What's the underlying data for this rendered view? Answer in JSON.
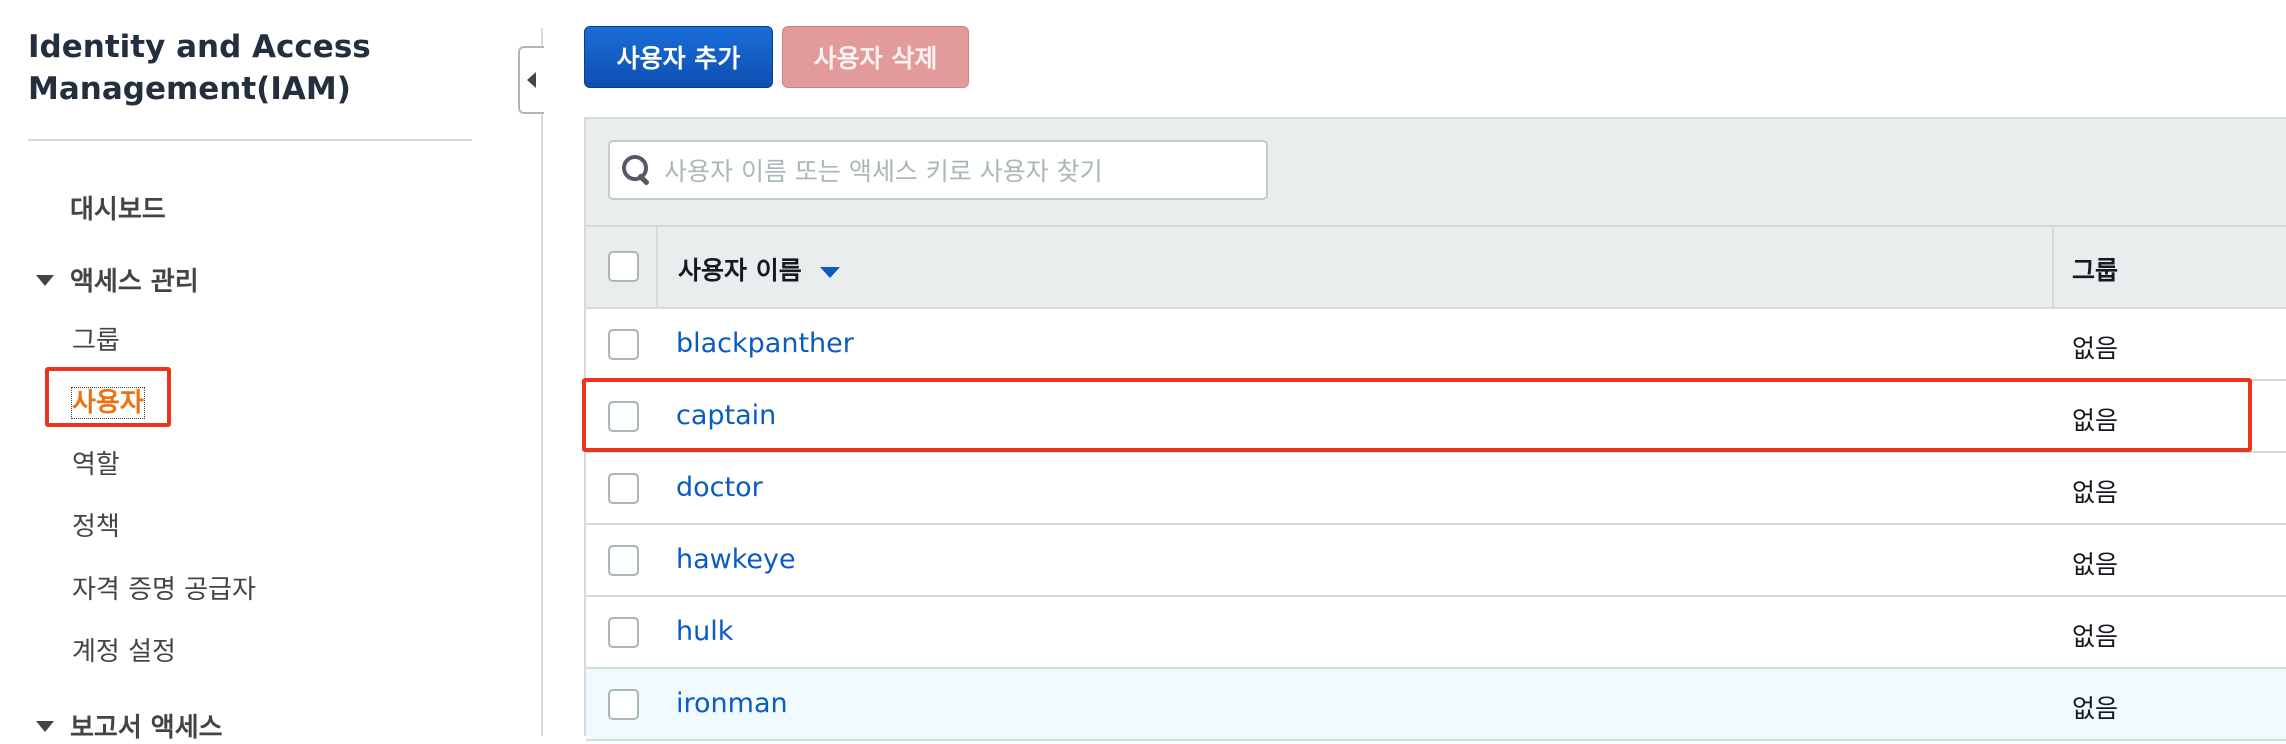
{
  "sidebar": {
    "title": "Identity and Access Management(IAM)",
    "dashboard": "대시보드",
    "access_section": "액세스 관리",
    "items": [
      "그룹",
      "사용자",
      "역할",
      "정책",
      "자격 증명 공급자",
      "계정 설정"
    ],
    "active_item": "사용자",
    "report_section": "보고서 액세스"
  },
  "toolbar": {
    "add_user_label": "사용자 추가",
    "delete_user_label": "사용자 삭제"
  },
  "search": {
    "placeholder": "사용자 이름 또는 액세스 키로 사용자 찾기"
  },
  "table": {
    "columns": [
      "사용자 이름",
      "그룹"
    ],
    "sort_column": "사용자 이름",
    "rows": [
      {
        "name": "blackpanther",
        "group": "없음"
      },
      {
        "name": "captain",
        "group": "없음"
      },
      {
        "name": "doctor",
        "group": "없음"
      },
      {
        "name": "hawkeye",
        "group": "없음"
      },
      {
        "name": "hulk",
        "group": "없음"
      },
      {
        "name": "ironman",
        "group": "없음"
      }
    ],
    "highlighted_row": "captain",
    "hovered_row": "ironman"
  },
  "colors": {
    "accent_blue": "#0a5bc2",
    "active_orange": "#ec7211",
    "highlight_red": "#e8341c",
    "delete_button": "#e39a9a"
  },
  "icons": [
    "search-icon",
    "collapse-arrow-icon",
    "sort-descending-icon",
    "expand-triangle-icon"
  ]
}
